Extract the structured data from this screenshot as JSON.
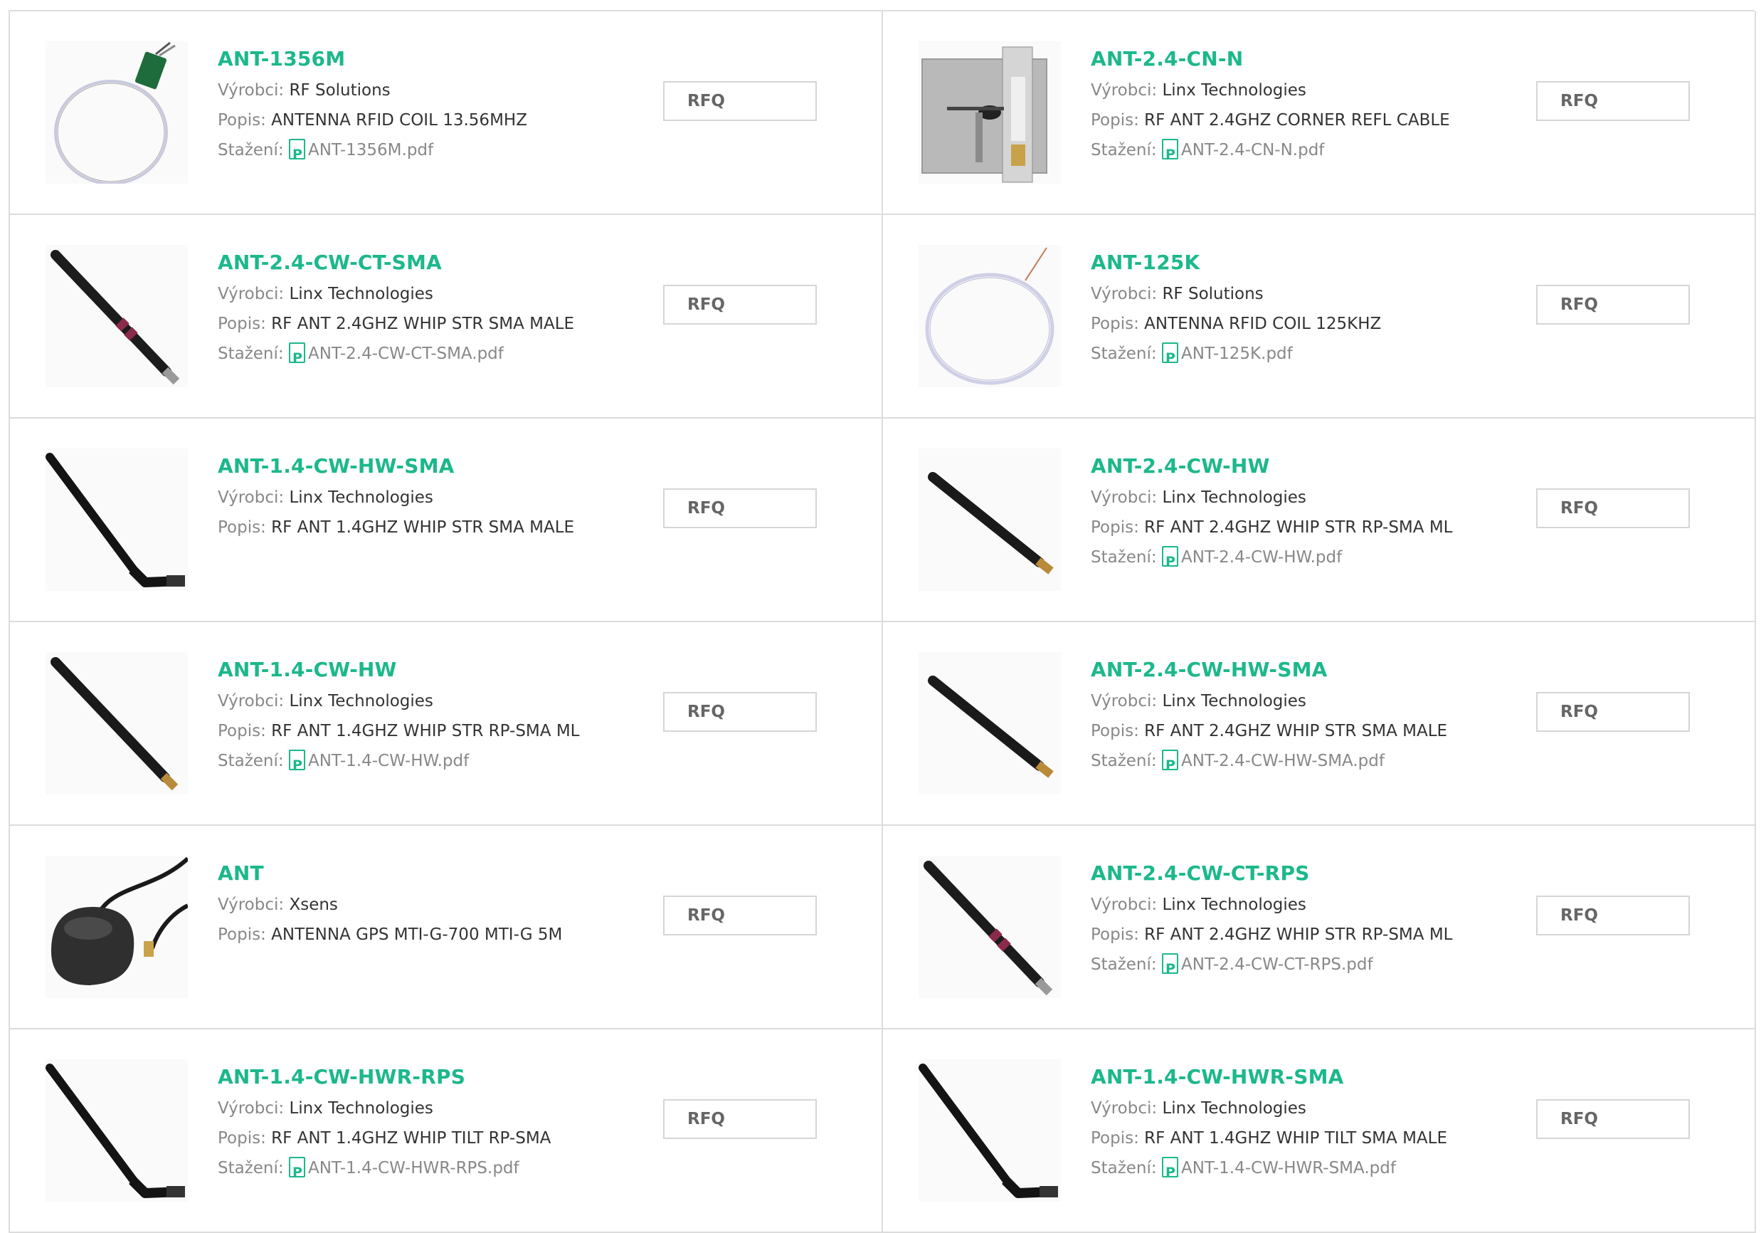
{
  "labels": {
    "manufacturer": "Výrobci:",
    "description": "Popis:",
    "download": "Stažení:",
    "rfq": "RFQ"
  },
  "products": [
    {
      "name": "ANT-1356M",
      "manufacturer": "RF Solutions",
      "description": "ANTENNA RFID COIL 13.56MHZ",
      "download": "ANT-1356M.pdf",
      "image": "coil-module"
    },
    {
      "name": "ANT-2.4-CN-N",
      "manufacturer": "Linx Technologies",
      "description": "RF ANT 2.4GHZ CORNER REFL CABLE",
      "download": "ANT-2.4-CN-N.pdf",
      "image": "corner-reflector"
    },
    {
      "name": "ANT-2.4-CW-CT-SMA",
      "manufacturer": "Linx Technologies",
      "description": "RF ANT 2.4GHZ WHIP STR SMA MALE",
      "download": "ANT-2.4-CW-CT-SMA.pdf",
      "image": "whip-straight-banded"
    },
    {
      "name": "ANT-125K",
      "manufacturer": "RF Solutions",
      "description": "ANTENNA RFID COIL 125KHZ",
      "download": "ANT-125K.pdf",
      "image": "coil"
    },
    {
      "name": "ANT-1.4-CW-HW-SMA",
      "manufacturer": "Linx Technologies",
      "description": "RF ANT 1.4GHZ WHIP STR SMA MALE",
      "download": "",
      "image": "whip-bent"
    },
    {
      "name": "ANT-2.4-CW-HW",
      "manufacturer": "Linx Technologies",
      "description": "RF ANT 2.4GHZ WHIP STR RP-SMA ML",
      "download": "ANT-2.4-CW-HW.pdf",
      "image": "whip-short"
    },
    {
      "name": "ANT-1.4-CW-HW",
      "manufacturer": "Linx Technologies",
      "description": "RF ANT 1.4GHZ WHIP STR RP-SMA ML",
      "download": "ANT-1.4-CW-HW.pdf",
      "image": "whip-straight"
    },
    {
      "name": "ANT-2.4-CW-HW-SMA",
      "manufacturer": "Linx Technologies",
      "description": "RF ANT 2.4GHZ WHIP STR SMA MALE",
      "download": "ANT-2.4-CW-HW-SMA.pdf",
      "image": "whip-short"
    },
    {
      "name": "ANT",
      "manufacturer": "Xsens",
      "description": "ANTENNA GPS MTI-G-700 MTI-G 5M",
      "download": "",
      "image": "gps-puck"
    },
    {
      "name": "ANT-2.4-CW-CT-RPS",
      "manufacturer": "Linx Technologies",
      "description": "RF ANT 2.4GHZ WHIP STR RP-SMA ML",
      "download": "ANT-2.4-CW-CT-RPS.pdf",
      "image": "whip-straight-banded"
    },
    {
      "name": "ANT-1.4-CW-HWR-RPS",
      "manufacturer": "Linx Technologies",
      "description": "RF ANT 1.4GHZ WHIP TILT RP-SMA",
      "download": "ANT-1.4-CW-HWR-RPS.pdf",
      "image": "whip-bent"
    },
    {
      "name": "ANT-1.4-CW-HWR-SMA",
      "manufacturer": "Linx Technologies",
      "description": "RF ANT 1.4GHZ WHIP TILT SMA MALE",
      "download": "ANT-1.4-CW-HWR-SMA.pdf",
      "image": "whip-bent"
    }
  ]
}
